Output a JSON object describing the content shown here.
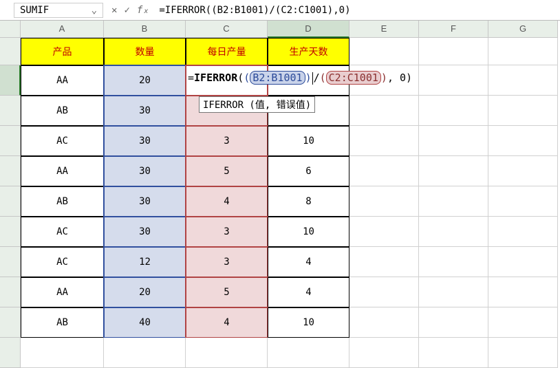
{
  "name_box": {
    "value": "SUMIF"
  },
  "formula_bar": {
    "value": "=IFERROR((B2:B1001)/(C2:C1001),0)"
  },
  "columns": [
    "A",
    "B",
    "C",
    "D",
    "E",
    "F",
    "G"
  ],
  "headers": {
    "a": "产品",
    "b": "数量",
    "c": "每日产量",
    "d": "生产天数"
  },
  "editing": {
    "eq": "=",
    "fn": "IFERROR",
    "op": "(",
    "pb_l": "(",
    "ref_b": "B2:B1001",
    "pb_r": ")",
    "div": "/",
    "pc_l": "(",
    "ref_c": "C2:C1001",
    "pc_r": ")",
    "tail": ", 0)",
    "tooltip": "IFERROR (值, 错误值)"
  },
  "rows": [
    {
      "a": "AA",
      "b": "20",
      "c": "",
      "d": ""
    },
    {
      "a": "AB",
      "b": "30",
      "c": "",
      "d": ""
    },
    {
      "a": "AC",
      "b": "30",
      "c": "3",
      "d": "10"
    },
    {
      "a": "AA",
      "b": "30",
      "c": "5",
      "d": "6"
    },
    {
      "a": "AB",
      "b": "30",
      "c": "4",
      "d": "8"
    },
    {
      "a": "AC",
      "b": "30",
      "c": "3",
      "d": "10"
    },
    {
      "a": "AC",
      "b": "12",
      "c": "3",
      "d": "4"
    },
    {
      "a": "AA",
      "b": "20",
      "c": "5",
      "d": "4"
    },
    {
      "a": "AB",
      "b": "40",
      "c": "4",
      "d": "10"
    }
  ]
}
